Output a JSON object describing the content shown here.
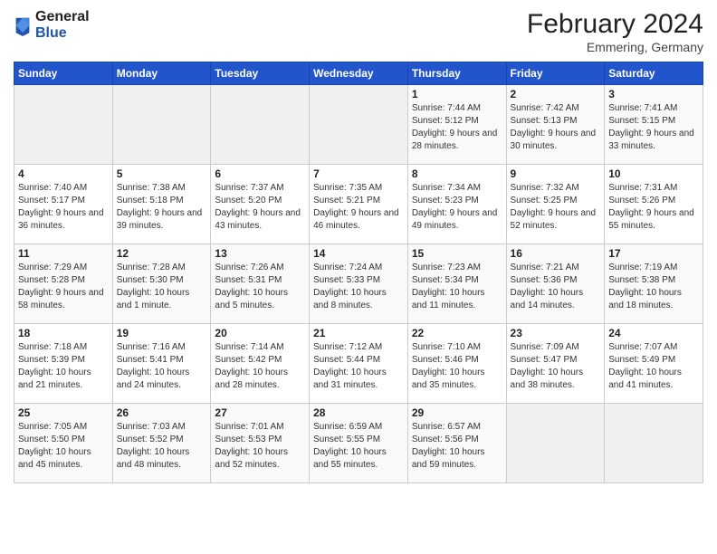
{
  "header": {
    "logo_general": "General",
    "logo_blue": "Blue",
    "month_year": "February 2024",
    "location": "Emmering, Germany"
  },
  "days_of_week": [
    "Sunday",
    "Monday",
    "Tuesday",
    "Wednesday",
    "Thursday",
    "Friday",
    "Saturday"
  ],
  "weeks": [
    [
      {
        "day": "",
        "info": ""
      },
      {
        "day": "",
        "info": ""
      },
      {
        "day": "",
        "info": ""
      },
      {
        "day": "",
        "info": ""
      },
      {
        "day": "1",
        "info": "Sunrise: 7:44 AM\nSunset: 5:12 PM\nDaylight: 9 hours and 28 minutes."
      },
      {
        "day": "2",
        "info": "Sunrise: 7:42 AM\nSunset: 5:13 PM\nDaylight: 9 hours and 30 minutes."
      },
      {
        "day": "3",
        "info": "Sunrise: 7:41 AM\nSunset: 5:15 PM\nDaylight: 9 hours and 33 minutes."
      }
    ],
    [
      {
        "day": "4",
        "info": "Sunrise: 7:40 AM\nSunset: 5:17 PM\nDaylight: 9 hours and 36 minutes."
      },
      {
        "day": "5",
        "info": "Sunrise: 7:38 AM\nSunset: 5:18 PM\nDaylight: 9 hours and 39 minutes."
      },
      {
        "day": "6",
        "info": "Sunrise: 7:37 AM\nSunset: 5:20 PM\nDaylight: 9 hours and 43 minutes."
      },
      {
        "day": "7",
        "info": "Sunrise: 7:35 AM\nSunset: 5:21 PM\nDaylight: 9 hours and 46 minutes."
      },
      {
        "day": "8",
        "info": "Sunrise: 7:34 AM\nSunset: 5:23 PM\nDaylight: 9 hours and 49 minutes."
      },
      {
        "day": "9",
        "info": "Sunrise: 7:32 AM\nSunset: 5:25 PM\nDaylight: 9 hours and 52 minutes."
      },
      {
        "day": "10",
        "info": "Sunrise: 7:31 AM\nSunset: 5:26 PM\nDaylight: 9 hours and 55 minutes."
      }
    ],
    [
      {
        "day": "11",
        "info": "Sunrise: 7:29 AM\nSunset: 5:28 PM\nDaylight: 9 hours and 58 minutes."
      },
      {
        "day": "12",
        "info": "Sunrise: 7:28 AM\nSunset: 5:30 PM\nDaylight: 10 hours and 1 minute."
      },
      {
        "day": "13",
        "info": "Sunrise: 7:26 AM\nSunset: 5:31 PM\nDaylight: 10 hours and 5 minutes."
      },
      {
        "day": "14",
        "info": "Sunrise: 7:24 AM\nSunset: 5:33 PM\nDaylight: 10 hours and 8 minutes."
      },
      {
        "day": "15",
        "info": "Sunrise: 7:23 AM\nSunset: 5:34 PM\nDaylight: 10 hours and 11 minutes."
      },
      {
        "day": "16",
        "info": "Sunrise: 7:21 AM\nSunset: 5:36 PM\nDaylight: 10 hours and 14 minutes."
      },
      {
        "day": "17",
        "info": "Sunrise: 7:19 AM\nSunset: 5:38 PM\nDaylight: 10 hours and 18 minutes."
      }
    ],
    [
      {
        "day": "18",
        "info": "Sunrise: 7:18 AM\nSunset: 5:39 PM\nDaylight: 10 hours and 21 minutes."
      },
      {
        "day": "19",
        "info": "Sunrise: 7:16 AM\nSunset: 5:41 PM\nDaylight: 10 hours and 24 minutes."
      },
      {
        "day": "20",
        "info": "Sunrise: 7:14 AM\nSunset: 5:42 PM\nDaylight: 10 hours and 28 minutes."
      },
      {
        "day": "21",
        "info": "Sunrise: 7:12 AM\nSunset: 5:44 PM\nDaylight: 10 hours and 31 minutes."
      },
      {
        "day": "22",
        "info": "Sunrise: 7:10 AM\nSunset: 5:46 PM\nDaylight: 10 hours and 35 minutes."
      },
      {
        "day": "23",
        "info": "Sunrise: 7:09 AM\nSunset: 5:47 PM\nDaylight: 10 hours and 38 minutes."
      },
      {
        "day": "24",
        "info": "Sunrise: 7:07 AM\nSunset: 5:49 PM\nDaylight: 10 hours and 41 minutes."
      }
    ],
    [
      {
        "day": "25",
        "info": "Sunrise: 7:05 AM\nSunset: 5:50 PM\nDaylight: 10 hours and 45 minutes."
      },
      {
        "day": "26",
        "info": "Sunrise: 7:03 AM\nSunset: 5:52 PM\nDaylight: 10 hours and 48 minutes."
      },
      {
        "day": "27",
        "info": "Sunrise: 7:01 AM\nSunset: 5:53 PM\nDaylight: 10 hours and 52 minutes."
      },
      {
        "day": "28",
        "info": "Sunrise: 6:59 AM\nSunset: 5:55 PM\nDaylight: 10 hours and 55 minutes."
      },
      {
        "day": "29",
        "info": "Sunrise: 6:57 AM\nSunset: 5:56 PM\nDaylight: 10 hours and 59 minutes."
      },
      {
        "day": "",
        "info": ""
      },
      {
        "day": "",
        "info": ""
      }
    ]
  ]
}
